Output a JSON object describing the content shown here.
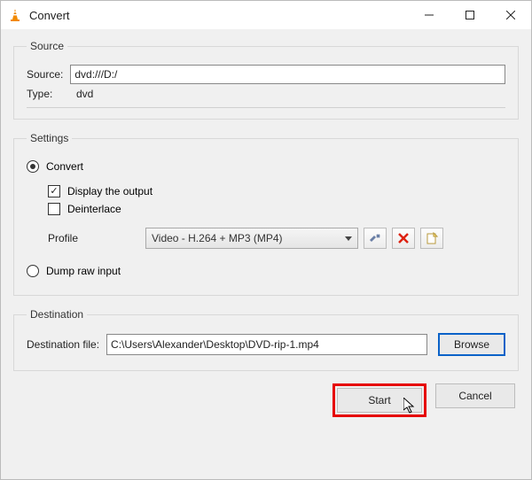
{
  "window": {
    "title": "Convert"
  },
  "source": {
    "legend": "Source",
    "source_label": "Source:",
    "source_value": "dvd:///D:/",
    "type_label": "Type:",
    "type_value": "dvd"
  },
  "settings": {
    "legend": "Settings",
    "convert_label": "Convert",
    "display_output_label": "Display the output",
    "deinterlace_label": "Deinterlace",
    "profile_label": "Profile",
    "profile_value": "Video - H.264 + MP3 (MP4)",
    "dump_label": "Dump raw input",
    "convert_selected": true,
    "display_output_checked": true,
    "deinterlace_checked": false,
    "dump_selected": false
  },
  "destination": {
    "legend": "Destination",
    "dest_label": "Destination file:",
    "dest_value": "C:\\Users\\Alexander\\Desktop\\DVD-rip-1.mp4",
    "browse_label": "Browse"
  },
  "footer": {
    "start_label": "Start",
    "cancel_label": "Cancel"
  }
}
